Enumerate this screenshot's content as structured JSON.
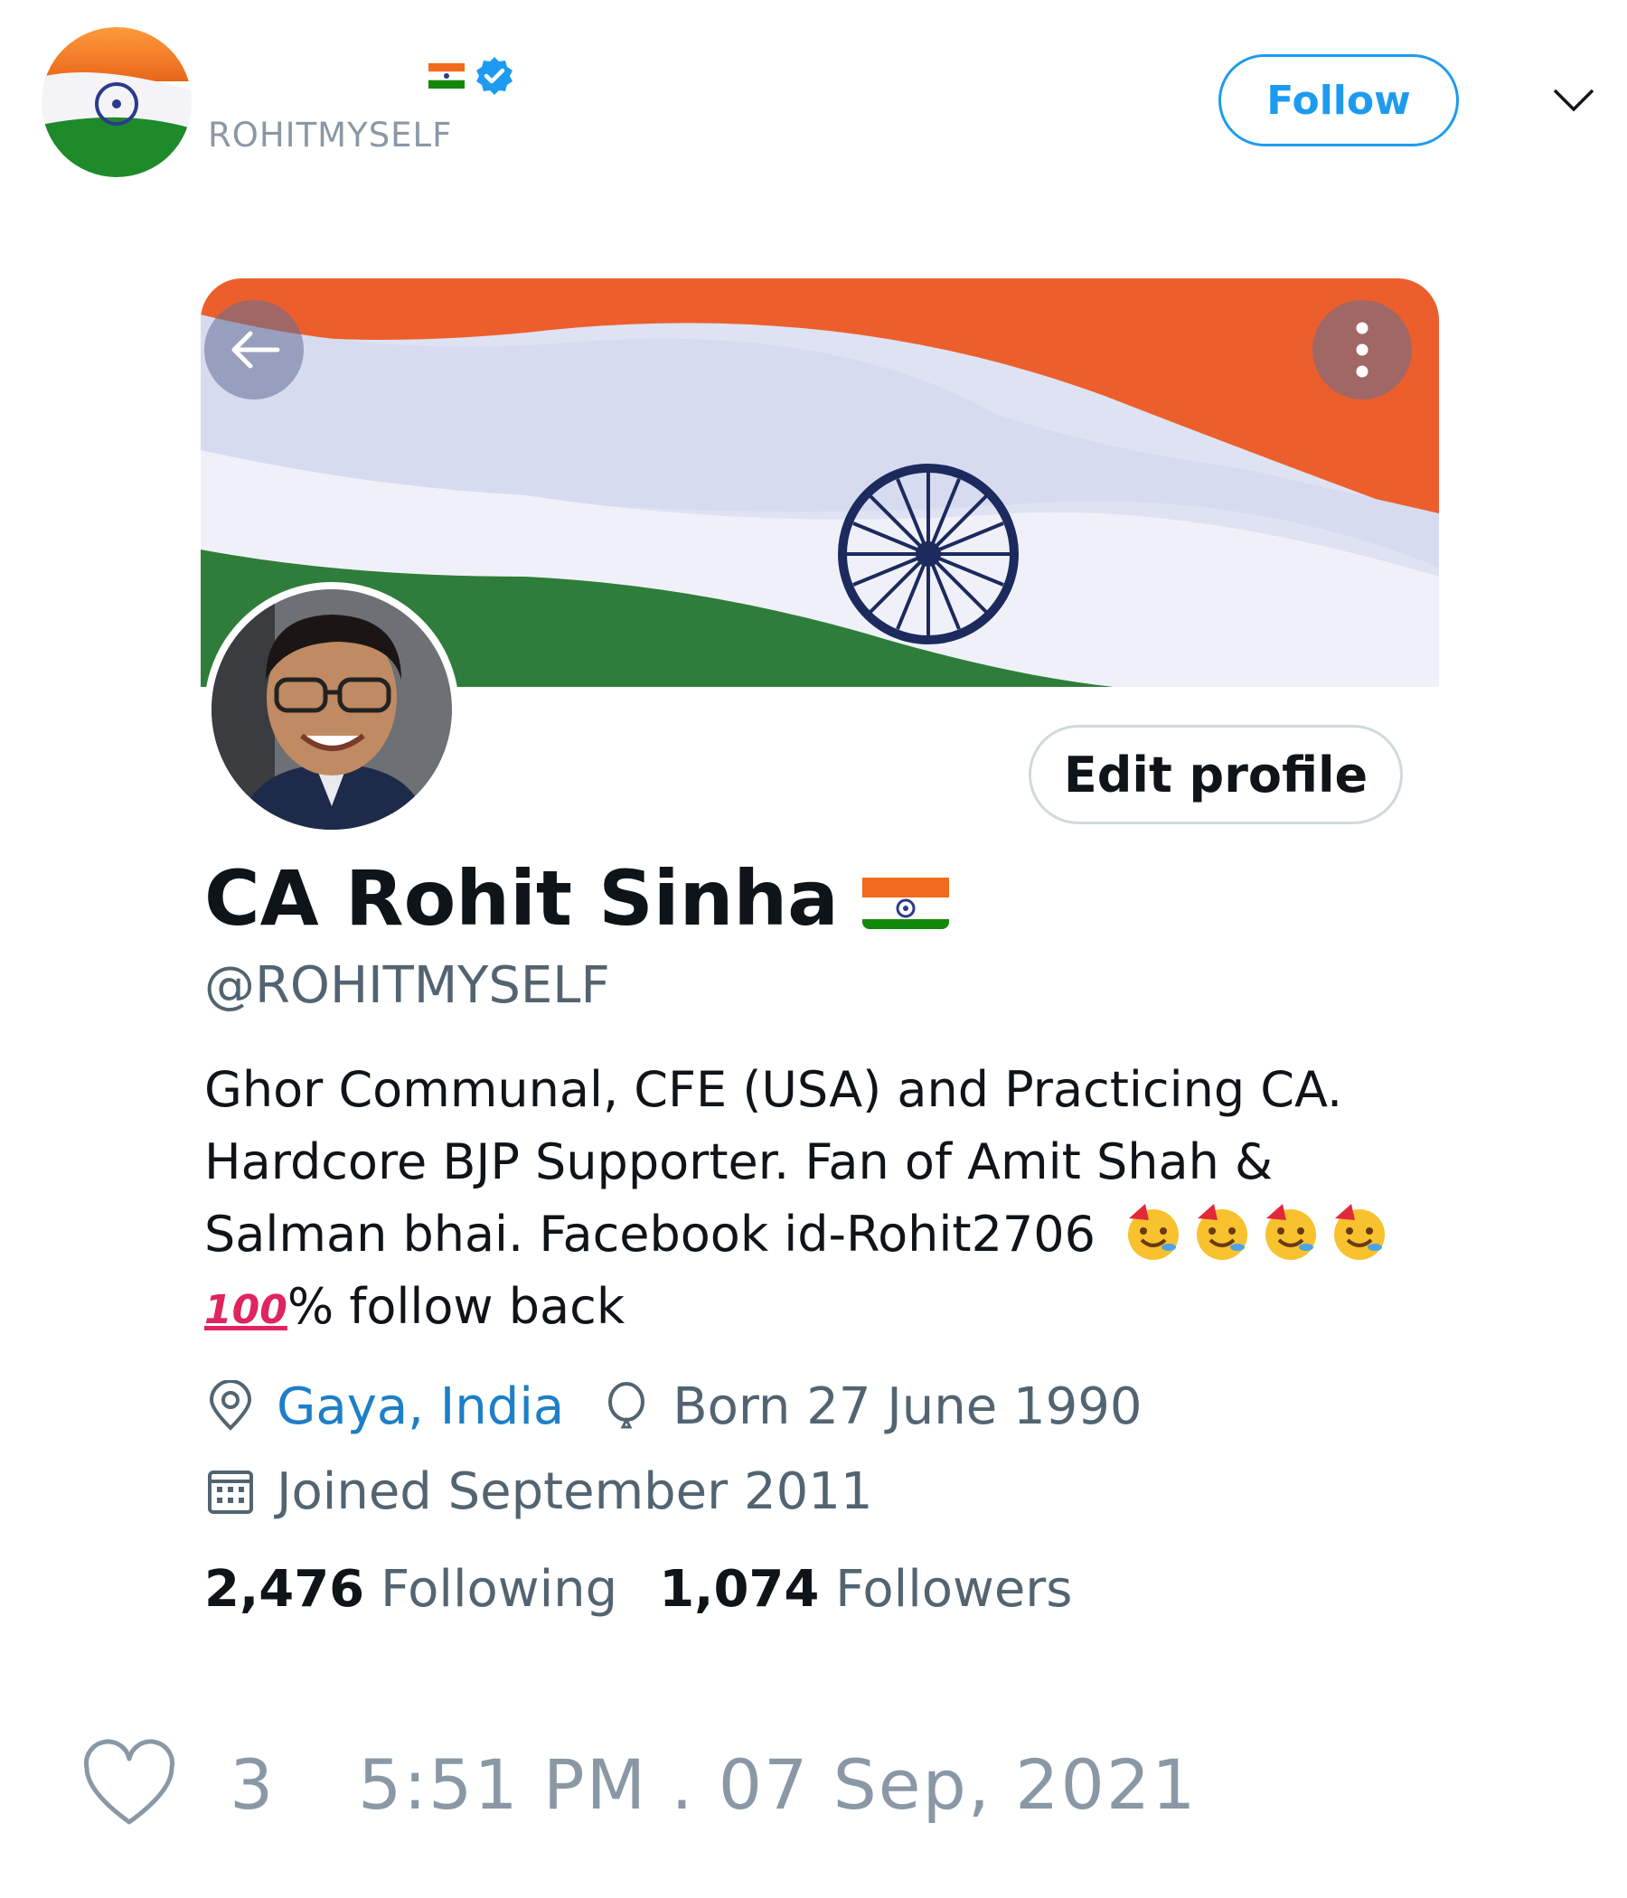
{
  "tweet_header": {
    "display_name": "",
    "name_emoji": "india-flag",
    "verified": true,
    "username": "ROHITMYSELF",
    "follow_label": "Follow",
    "menu_icon": "chevron-down-icon"
  },
  "profile": {
    "display_name": "CA Rohit Sinha",
    "handle": "@ROHITMYSELF",
    "edit_profile_label": "Edit profile",
    "bio_line1": "Ghor Communal, CFE (USA) and Practicing CA.",
    "bio_line2": "Hardcore BJP Supporter. Fan of Amit Shah &",
    "bio_line3": "Salman bhai. Facebook id-Rohit2706",
    "bio_emoji_100": "100",
    "bio_line4": "% follow back",
    "location": "Gaya, India",
    "born": "Born 27 June 1990",
    "joined": "Joined September 2011",
    "following_count": "2,476",
    "following_label": "Following",
    "followers_count": "1,074",
    "followers_label": "Followers"
  },
  "footer": {
    "likes": "3",
    "timestamp": "5:51 PM . 07 Sep, 2021"
  },
  "colors": {
    "accent": "#1d9bf0",
    "link": "#1d7fc7",
    "secondary_text": "#536471",
    "saffron": "#f26a1b",
    "green": "#138808"
  }
}
